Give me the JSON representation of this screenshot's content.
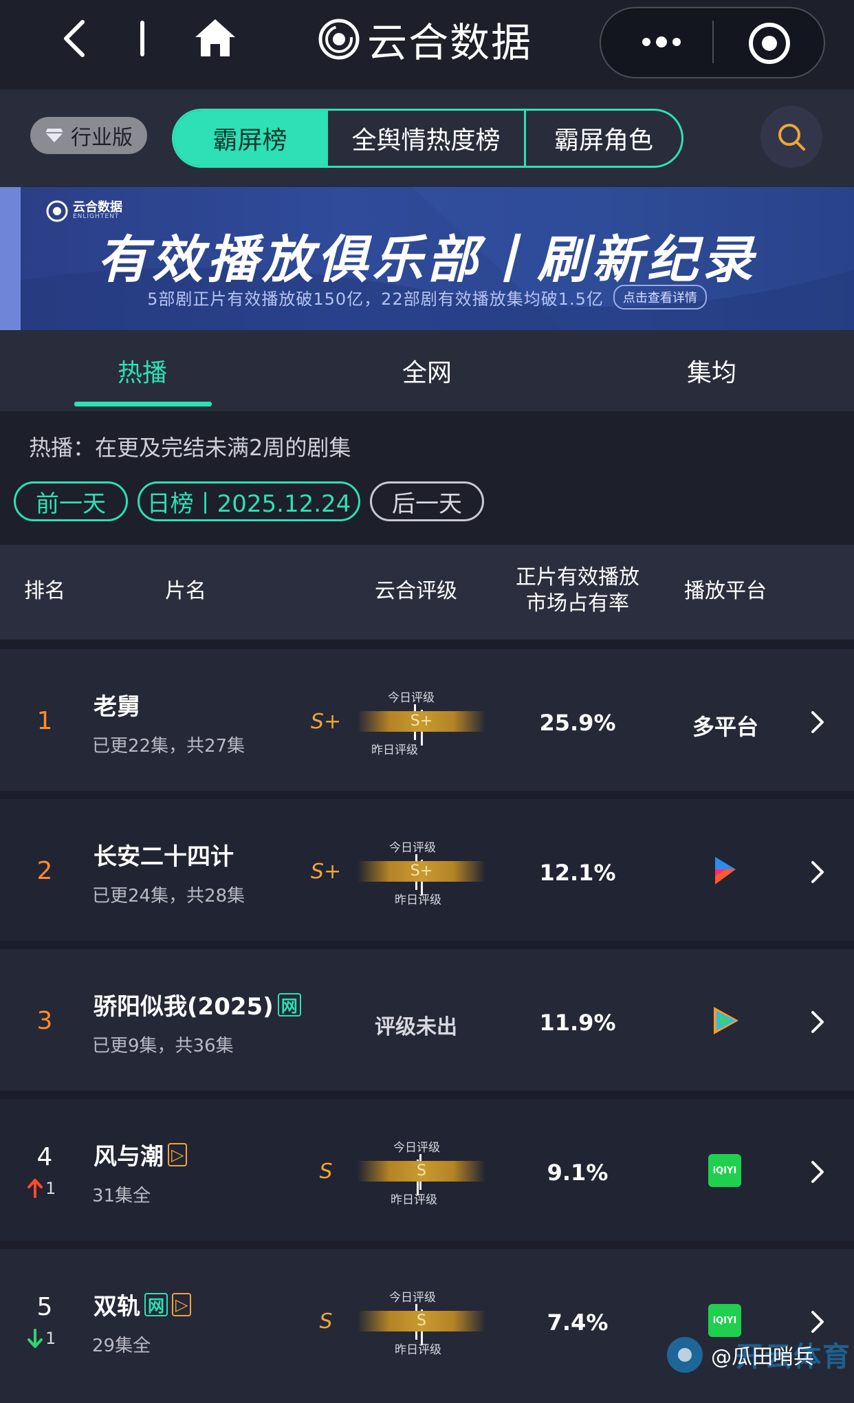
{
  "titlebar": {
    "app_title": "云合数据"
  },
  "topnav": {
    "industry_label": "行业版",
    "segments": [
      "霸屏榜",
      "全舆情热度榜",
      "霸屏角色"
    ]
  },
  "banner": {
    "logo_text": "云合数据",
    "logo_sub": "ENLIGHTENT",
    "title": "有效播放俱乐部丨刷新纪录",
    "subtitle": "5部剧正片有效播放破150亿，22部剧有效播放集均破1.5亿",
    "detail_label": "点击查看详情"
  },
  "tabs": [
    "热播",
    "全网",
    "集均"
  ],
  "filter": {
    "description": "热播：在更及完结未满2周的剧集",
    "prev_label": "前一天",
    "day_rank_label": "日榜丨2025.12.24",
    "next_label": "后一天"
  },
  "table": {
    "headers": {
      "rank": "排名",
      "title": "片名",
      "grade": "云合评级",
      "share_line1": "正片有效播放",
      "share_line2": "市场占有率",
      "platform": "播放平台"
    },
    "grade_today_label": "今日评级",
    "grade_yesterday_label": "昨日评级",
    "rows": [
      {
        "rank": "1",
        "title": "老舅",
        "episodes": "已更22集，共27集",
        "grade": "S+",
        "grade_bar": "S+",
        "share": "25.9%",
        "platform": "多平台"
      },
      {
        "rank": "2",
        "title": "长安二十四计",
        "episodes": "已更24集，共28集",
        "grade": "S+",
        "grade_bar": "S+",
        "share": "12.1%",
        "platform_icon": "youku-icon"
      },
      {
        "rank": "3",
        "title": "骄阳似我(2025)",
        "tag": "网",
        "episodes": "已更9集，共36集",
        "grade_none": "评级未出",
        "share": "11.9%",
        "platform_icon": "tencent-video-icon"
      },
      {
        "rank": "4",
        "title": "风与潮",
        "tag_gold": "▷",
        "episodes": "31集全",
        "grade": "S",
        "grade_bar": "S",
        "share": "9.1%",
        "platform_icon": "iqiyi-icon",
        "platform_icon_text": "iQIYI",
        "move": "1",
        "move_dir": "up"
      },
      {
        "rank": "5",
        "title": "双轨",
        "tag": "网",
        "tag_gold": "▷",
        "episodes": "29集全",
        "grade": "S",
        "grade_bar": "S",
        "share": "7.4%",
        "platform_icon": "iqiyi-icon",
        "platform_icon_text": "iQIYI",
        "move": "1",
        "move_dir": "down"
      }
    ]
  },
  "watermark": {
    "weibo": "@瓜田哨兵",
    "kai": "开云体育"
  },
  "colors": {
    "accent": "#2de0b5",
    "rank_orange": "#ff8b2b",
    "grade_gold": "#f0a53a",
    "background": "#1b1d2a"
  }
}
